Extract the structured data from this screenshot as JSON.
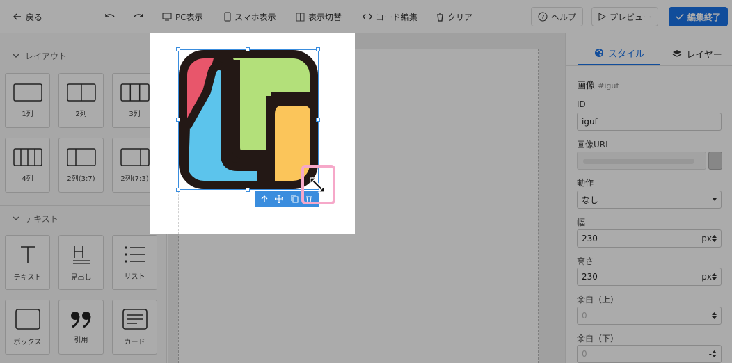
{
  "toolbar": {
    "back": "戻る",
    "pc_view": "PC表示",
    "mobile_view": "スマホ表示",
    "toggle_view": "表示切替",
    "code_edit": "コード編集",
    "clear": "クリア",
    "help": "ヘルプ",
    "preview": "プレビュー",
    "finish_edit": "編集終了"
  },
  "left_panel": {
    "layout_section": "レイアウト",
    "layout_blocks": [
      "1列",
      "2列",
      "3列",
      "4列",
      "2列(3:7)",
      "2列(7:3)"
    ],
    "text_section": "テキスト",
    "text_blocks": [
      "テキスト",
      "見出し",
      "リスト",
      "ボックス",
      "引用",
      "カード"
    ]
  },
  "right_panel": {
    "tabs": {
      "style": "スタイル",
      "layer": "レイヤー"
    },
    "element_title": "画像",
    "element_id_tag": "#iguf",
    "fields": {
      "id_label": "ID",
      "id_value": "iguf",
      "image_url_label": "画像URL",
      "action_label": "動作",
      "action_value": "なし",
      "width_label": "幅",
      "width_value": "230",
      "width_unit": "px",
      "height_label": "高さ",
      "height_value": "230",
      "height_unit": "px",
      "margin_top_label": "余白（上）",
      "margin_top_value": "0",
      "margin_top_unit": "-",
      "margin_bottom_label": "余白（下）",
      "margin_bottom_value": "0",
      "margin_bottom_unit": "-"
    }
  },
  "colors": {
    "accent": "#1a73e8",
    "selection": "#3a8dde",
    "highlight": "#f6a8c9",
    "logo_red": "#e8566b",
    "logo_green": "#b3e07a",
    "logo_blue": "#5cc4ec",
    "logo_yellow": "#fbc55a",
    "logo_outline": "#231815"
  },
  "icons": [
    "arrow-left-icon",
    "undo-icon",
    "redo-icon",
    "monitor-icon",
    "smartphone-icon",
    "grid-icon",
    "code-icon",
    "trash-icon",
    "help-circle-icon",
    "play-icon",
    "check-icon",
    "chevron-down-icon",
    "palette-icon",
    "layers-icon",
    "arrow-up-icon",
    "move-icon",
    "copy-icon",
    "resize-diagonal-icon"
  ]
}
